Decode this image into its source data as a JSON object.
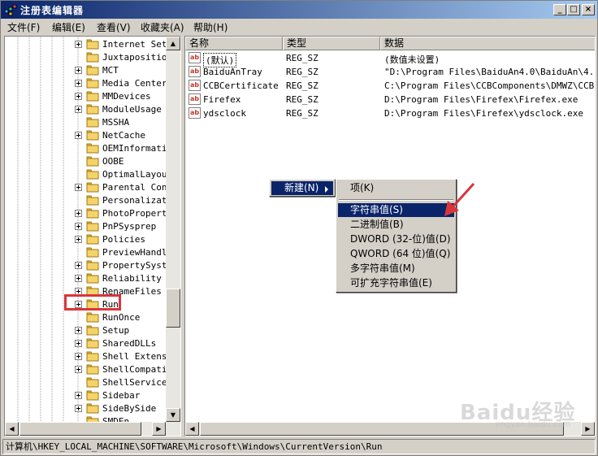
{
  "window": {
    "title": "注册表编辑器",
    "controls": [
      "_",
      "□",
      "×"
    ]
  },
  "menubar": {
    "items": [
      "文件(F)",
      "编辑(E)",
      "查看(V)",
      "收藏夹(A)",
      "帮助(H)"
    ]
  },
  "tree": {
    "items": [
      {
        "label": "Internet Sett",
        "expandable": true
      },
      {
        "label": "Juxtaposition",
        "expandable": false
      },
      {
        "label": "MCT",
        "expandable": true
      },
      {
        "label": "Media Center",
        "expandable": true
      },
      {
        "label": "MMDevices",
        "expandable": true
      },
      {
        "label": "ModuleUsage",
        "expandable": true
      },
      {
        "label": "MSSHA",
        "expandable": false
      },
      {
        "label": "NetCache",
        "expandable": true
      },
      {
        "label": "OEMInformatic",
        "expandable": false
      },
      {
        "label": "OOBE",
        "expandable": false
      },
      {
        "label": "OptimalLayout",
        "expandable": false
      },
      {
        "label": "Parental Cont",
        "expandable": true
      },
      {
        "label": "Personalizati",
        "expandable": false
      },
      {
        "label": "PhotoProperty",
        "expandable": true
      },
      {
        "label": "PnPSysprep",
        "expandable": true
      },
      {
        "label": "Policies",
        "expandable": true
      },
      {
        "label": "PreviewHandle",
        "expandable": false
      },
      {
        "label": "PropertySyste",
        "expandable": true
      },
      {
        "label": "Reliability",
        "expandable": true
      },
      {
        "label": "RenameFiles",
        "expandable": true
      },
      {
        "label": "Run",
        "expandable": true
      },
      {
        "label": "RunOnce",
        "expandable": false
      },
      {
        "label": "Setup",
        "expandable": true
      },
      {
        "label": "SharedDLLs",
        "expandable": true
      },
      {
        "label": "Shell Extensi",
        "expandable": true
      },
      {
        "label": "ShellCompatib",
        "expandable": true
      },
      {
        "label": "ShellServiceO",
        "expandable": false
      },
      {
        "label": "Sidebar",
        "expandable": true
      },
      {
        "label": "SideBySide",
        "expandable": true
      },
      {
        "label": "SMDEn",
        "expandable": false
      }
    ],
    "selected": "Run"
  },
  "list": {
    "columns": [
      "名称",
      "类型",
      "数据"
    ],
    "rows": [
      {
        "name": "(默认)",
        "type": "REG_SZ",
        "data": "(数值未设置)"
      },
      {
        "name": "BaiduAnTray",
        "type": "REG_SZ",
        "data": "\"D:\\Program Files\\BaiduAn4.0\\BaiduAn\\4.0.0."
      },
      {
        "name": "CCBCertificate",
        "type": "REG_SZ",
        "data": "C:\\Program Files\\CCBComponents\\DMWZ\\CCBCert"
      },
      {
        "name": "Firefex",
        "type": "REG_SZ",
        "data": "D:\\Program Files\\Firefex\\Firefex.exe"
      },
      {
        "name": "ydsclock",
        "type": "REG_SZ",
        "data": "D:\\Program Files\\Firefex\\ydsclock.exe"
      }
    ]
  },
  "context_menu": {
    "new_label": "新建(N)",
    "submenu": [
      {
        "label": "项(K)",
        "active": false
      },
      {
        "label": "字符串值(S)",
        "active": true
      },
      {
        "label": "二进制值(B)",
        "active": false
      },
      {
        "label": "DWORD (32-位)值(D)",
        "active": false
      },
      {
        "label": "QWORD (64 位)值(Q)",
        "active": false
      },
      {
        "label": "多字符串值(M)",
        "active": false
      },
      {
        "label": "可扩充字符串值(E)",
        "active": false
      }
    ]
  },
  "statusbar": {
    "path": "计算机\\HKEY_LOCAL_MACHINE\\SOFTWARE\\Microsoft\\Windows\\CurrentVersion\\Run"
  },
  "watermark": {
    "brand": "Baidu经验",
    "url": "jingyan.baidu.com"
  },
  "colors": {
    "titlebar": "#0a246a",
    "selection": "#0a246a",
    "annotation_red": "#d9353b",
    "window_face": "#d4d0c8"
  },
  "icons": {
    "app": "registry-editor-icon",
    "folder": "folder-icon",
    "value": "ab-string-value-icon"
  }
}
